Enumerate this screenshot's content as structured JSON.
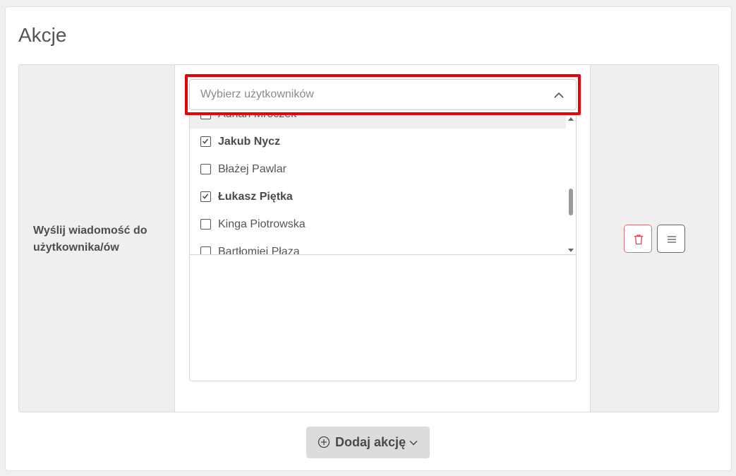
{
  "page": {
    "title": "Akcje"
  },
  "action": {
    "label": "Wyślij wiadomość do użytkownika/ów",
    "select": {
      "placeholder": "Wybierz użytkowników",
      "expanded": true
    },
    "options": [
      {
        "label": "Adrian Mroczek",
        "checked": false,
        "hover": true
      },
      {
        "label": "Jakub Nycz",
        "checked": true,
        "hover": false
      },
      {
        "label": "Błażej Pawlar",
        "checked": false,
        "hover": false
      },
      {
        "label": "Łukasz Piętka",
        "checked": true,
        "hover": false
      },
      {
        "label": "Kinga Piotrowska",
        "checked": false,
        "hover": false
      },
      {
        "label": "Bartłomiej Płaza",
        "checked": false,
        "hover": false
      }
    ],
    "buttons": {
      "delete_icon": "trash-icon",
      "menu_icon": "hamburger-icon"
    }
  },
  "footer": {
    "add_action_label": "Dodaj akcję",
    "add_icon": "plus-circle-icon",
    "dropdown_icon": "chevron-down-icon"
  },
  "colors": {
    "highlight": "#e8000b",
    "delete_border": "#e07078",
    "panel_bg": "#efefef"
  }
}
